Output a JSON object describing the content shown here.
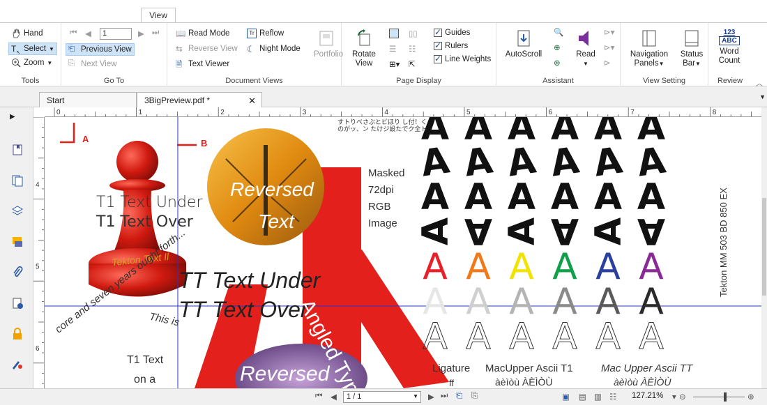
{
  "ribbon_tab": "View",
  "tools": {
    "hand": "Hand",
    "select": "Select",
    "zoom": "Zoom",
    "label": "Tools"
  },
  "goto": {
    "page_value": "1",
    "previous_view": "Previous View",
    "next_view": "Next View",
    "label": "Go To"
  },
  "document_views": {
    "read_mode": "Read Mode",
    "reflow": "Reflow",
    "reverse_view": "Reverse View",
    "night_mode": "Night Mode",
    "text_viewer": "Text Viewer",
    "portfolio": "Portfolio",
    "label": "Document Views"
  },
  "page_display": {
    "rotate_view": "Rotate",
    "rotate_view2": "View",
    "guides": "Guides",
    "rulers": "Rulers",
    "line_weights": "Line Weights",
    "label": "Page Display"
  },
  "assistant": {
    "autoscroll": "AutoScroll",
    "read": "Read",
    "label": "Assistant"
  },
  "view_setting": {
    "navigation_panels": "Navigation",
    "navigation_panels2": "Panels",
    "status_bar": "Status",
    "status_bar2": "Bar",
    "label": "View Setting"
  },
  "review": {
    "word_count_icon1": "123",
    "word_count_icon2": "ABC",
    "word_count": "Word",
    "word_count2": "Count",
    "label": "Review"
  },
  "doc_tabs": {
    "start": "Start",
    "file": "3BigPreview.pdf *"
  },
  "ruler": {
    "h_marks": [
      "0",
      "1",
      "2",
      "3",
      "4",
      "5",
      "6",
      "7",
      "8"
    ],
    "v_marks": [
      "4",
      "5",
      "6"
    ]
  },
  "content": {
    "marker_a": "A",
    "marker_b": "B",
    "t1_under": "T1 Text Under",
    "t1_over": "T1 Text Over",
    "tekton_ring": "Tekton Text Il",
    "reversed": "Reversed",
    "text": "Text",
    "tt_under": "TT Text Under",
    "tt_over": "TT Text Over",
    "angled": "Angled Type",
    "masked": "Masked",
    "dpi": "72dpi",
    "rgb": "RGB",
    "image": "Image",
    "japanese": "すトりべさぶとビほり し付！くのがッ、ン たけジ設たでク全ト",
    "circle_text": "core and seven years ought forth...",
    "this_is": "This is",
    "t1_text": "T1 Text",
    "on_a": "on a",
    "reversed2": "Reversed",
    "ligature": "Ligature",
    "lig_glyph": "ff",
    "macupper": "MacUpper Ascii T1",
    "mac_chars": "àèìòù ÀÈÌÒÙ",
    "macupper_tt": "Mac Upper Ascii TT",
    "mac_chars2": "àèìòù ÀÈÌÒÙ",
    "vertical": "Tekton MM 503 BD 850 EX",
    "glyph": "A"
  },
  "status": {
    "page": "1 / 1",
    "zoom": "127.21%"
  },
  "colors": {
    "red": "#e3201b",
    "blue_line": "#2a36c8",
    "accent": "#1a4da0",
    "rainbow": [
      "#e8202a",
      "#f07a1a",
      "#f2e200",
      "#11a04a",
      "#2b3f9c",
      "#8a2a96"
    ]
  }
}
